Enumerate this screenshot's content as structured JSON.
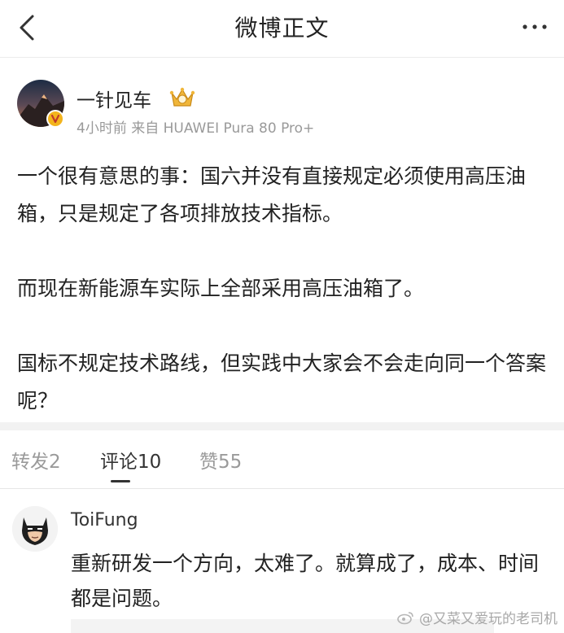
{
  "header": {
    "title": "微博正文",
    "back_icon": "chevron-left-icon",
    "more_icon": "more-horizontal-icon"
  },
  "post": {
    "author": "一针见车",
    "meta": "4小时前 来自 HUAWEI Pura 80 Pro+",
    "paragraphs": [
      "一个很有意思的事：国六并没有直接规定必须使用高压油箱，只是规定了各项排放技术指标。",
      "而现在新能源车实际上全部采用高压油箱了。",
      "国标不规定技术路线，但实践中大家会不会走向同一个答案呢？"
    ],
    "verified_badge": "v",
    "accent": "#f3b41d"
  },
  "tabs": [
    {
      "label": "转发2",
      "active": false
    },
    {
      "label": "评论10",
      "active": true
    },
    {
      "label": "赞55",
      "active": false
    }
  ],
  "comment": {
    "name": "ToiFung",
    "text": "重新研发一个方向，太难了。就算成了，成本、时间都是问题。"
  },
  "watermark": "@又菜又爱玩的老司机"
}
